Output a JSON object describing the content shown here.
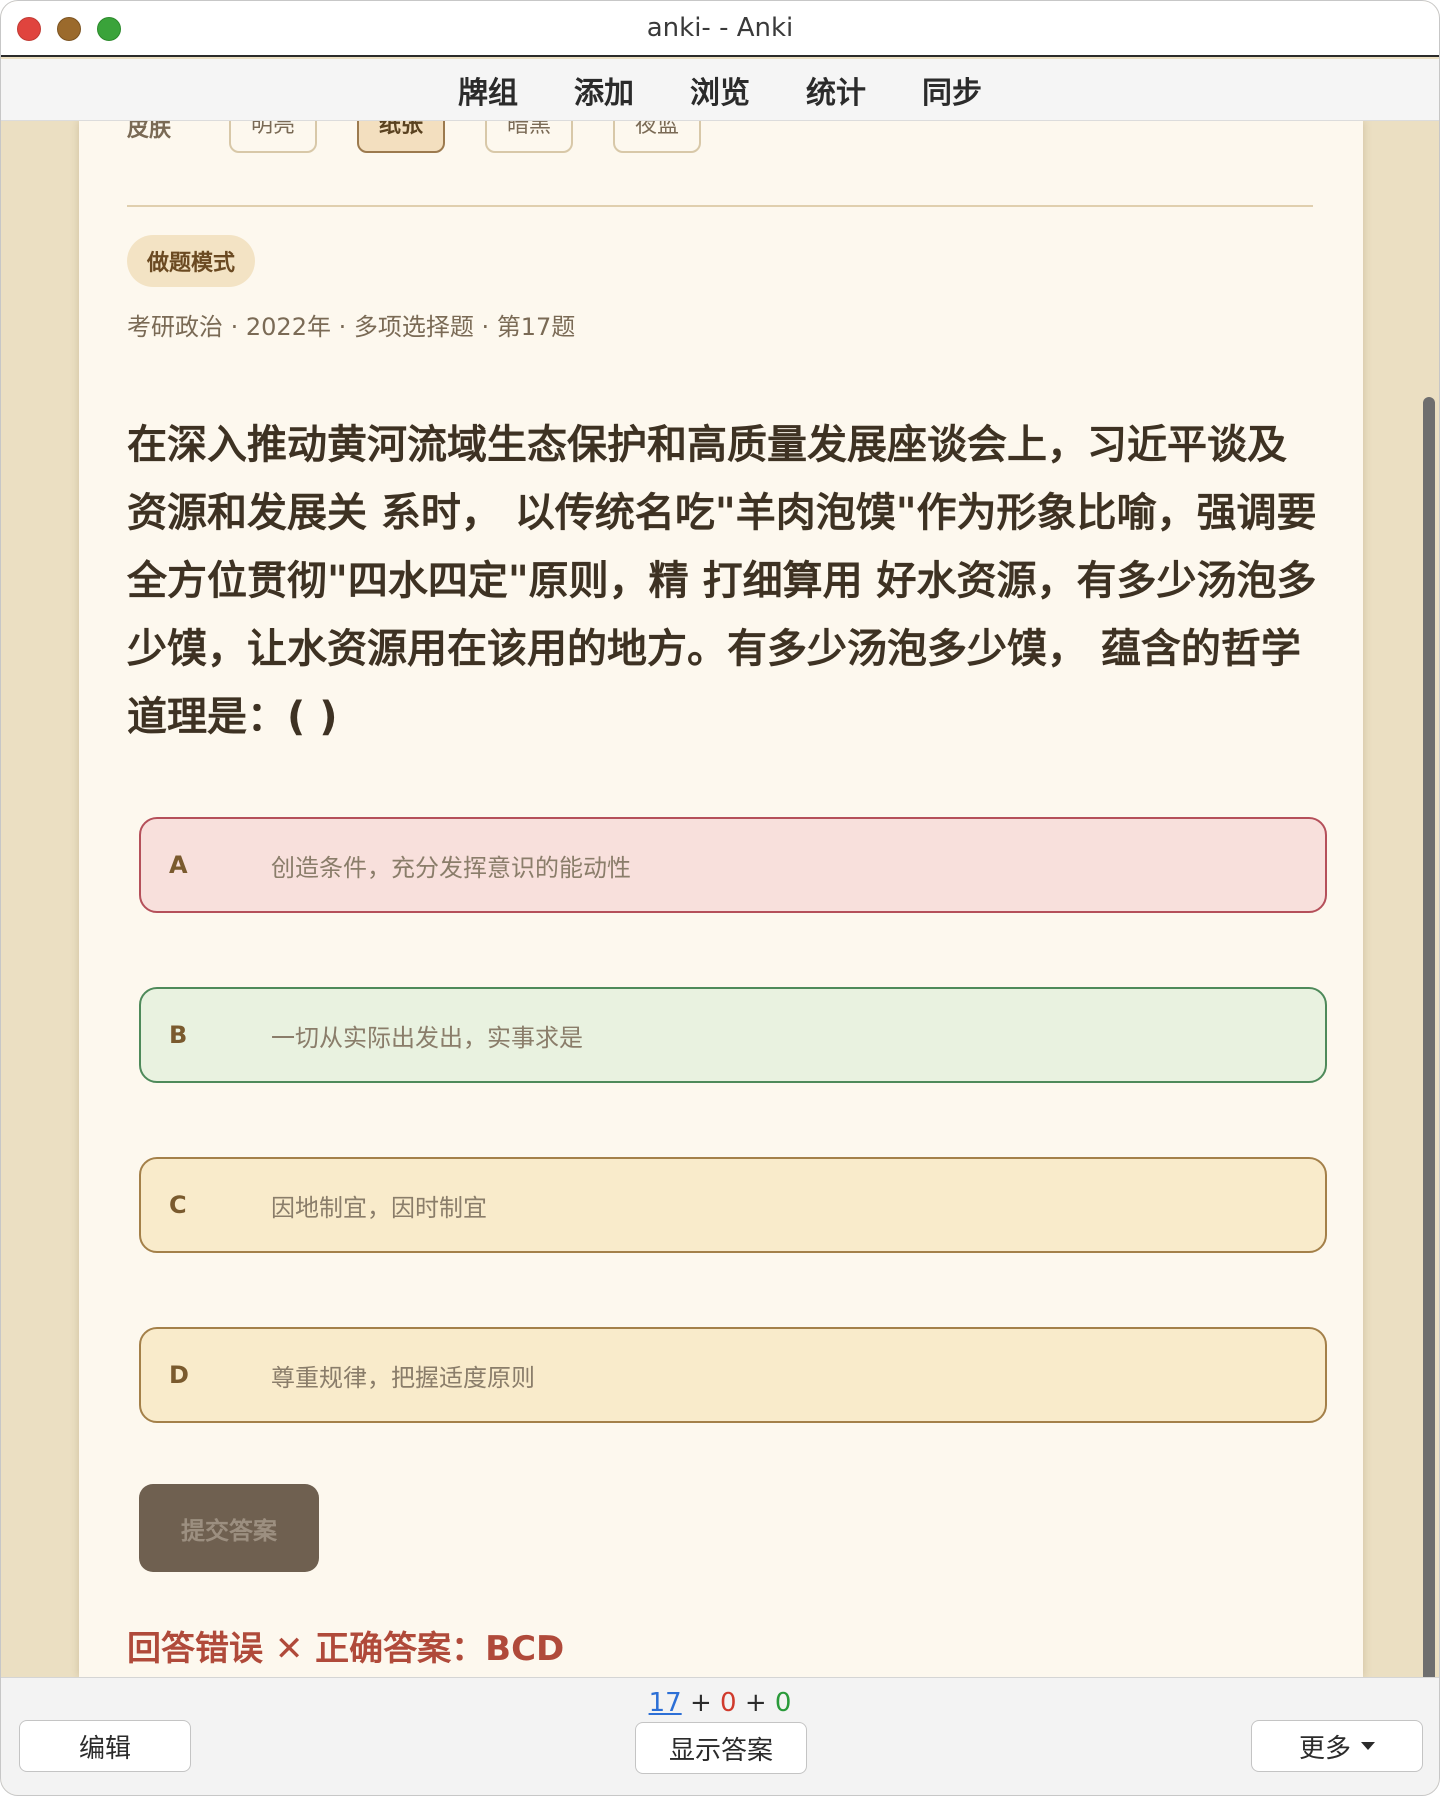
{
  "window": {
    "title": "anki- - Anki"
  },
  "toolbar": {
    "items": [
      {
        "label": "牌组"
      },
      {
        "label": "添加"
      },
      {
        "label": "浏览"
      },
      {
        "label": "统计"
      },
      {
        "label": "同步"
      }
    ]
  },
  "card": {
    "skin": {
      "label": "皮肤",
      "options": [
        "明亮",
        "纸张",
        "暗黑",
        "夜蓝"
      ],
      "selected": "纸张"
    },
    "mode_badge": "做题模式",
    "meta": "考研政治 · 2022年 · 多项选择题 · 第17题",
    "question": "在深入推动黄河流域生态保护和高质量发展座谈会上，习近平谈及资源和发展关 系时， 以传统名吃\"羊肉泡馍\"作为形象比喻，强调要全方位贯彻\"四水四定\"原则，精 打细算用 好水资源，有多少汤泡多少馍，让水资源用在该用的地方。有多少汤泡多少馍， 蕴含的哲学 道理是：( )",
    "options": [
      {
        "letter": "A",
        "text": "创造条件，充分发挥意识的能动性",
        "state": "wrong"
      },
      {
        "letter": "B",
        "text": "一切从实际出发出，实事求是",
        "state": "correct"
      },
      {
        "letter": "C",
        "text": "因地制宜，因时制宜",
        "state": "neutral"
      },
      {
        "letter": "D",
        "text": "尊重规律，把握适度原则",
        "state": "neutral"
      }
    ],
    "submit_label": "提交答案",
    "result": "回答错误 ✕ 正确答案：BCD"
  },
  "bottom": {
    "counts": {
      "new": "17",
      "learn": "0",
      "review": "0",
      "sep": "+"
    },
    "edit_label": "编辑",
    "show_answer_label": "显示答案",
    "more_label": "更多"
  },
  "colors": {
    "background": "#ebdfc2",
    "card": "#fdf8ee",
    "wrong_option": "#f8e0dc",
    "correct_option": "#e9f2e0",
    "neutral_option": "#f9ebcb",
    "result_text": "#b04a3a",
    "count_new": "#2c6fd6",
    "count_learn": "#d03a2c",
    "count_review": "#2a9a3a"
  },
  "icons": {
    "close": "close-window-icon",
    "minimize": "minimize-window-icon",
    "zoom": "zoom-window-icon",
    "more_caret": "chevron-down-icon"
  }
}
